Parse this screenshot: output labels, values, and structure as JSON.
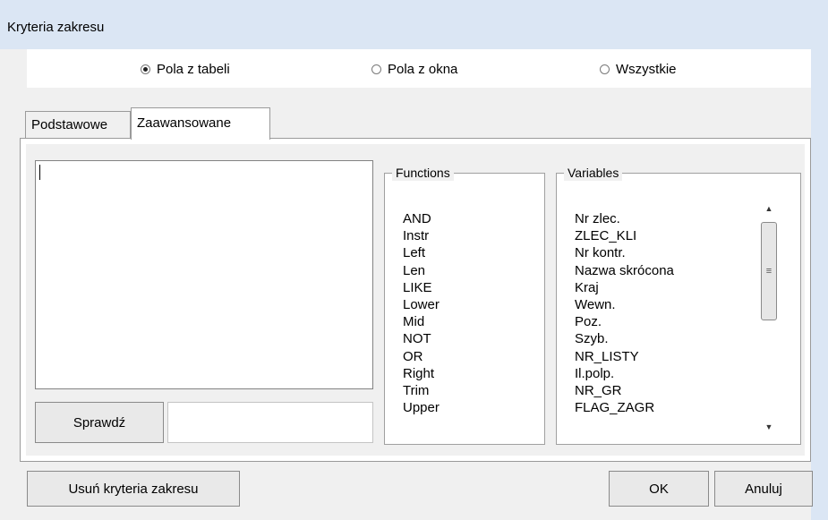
{
  "window": {
    "title": "Kryteria zakresu"
  },
  "scope": {
    "options": [
      {
        "label": "Pola z tabeli",
        "selected": true
      },
      {
        "label": "Pola z okna",
        "selected": false
      },
      {
        "label": "Wszystkie",
        "selected": false
      }
    ]
  },
  "tabs": [
    {
      "label": "Podstawowe",
      "active": false
    },
    {
      "label": "Zaawansowane",
      "active": true
    }
  ],
  "editor": {
    "value": "",
    "check_button": "Sprawdź",
    "result_text": ""
  },
  "functions": {
    "legend": "Functions",
    "items": [
      "AND",
      "Instr",
      "Left",
      "Len",
      "LIKE",
      "Lower",
      "Mid",
      "NOT",
      "OR",
      "Right",
      "Trim",
      "Upper"
    ]
  },
  "variables": {
    "legend": "Variables",
    "items": [
      "Nr zlec.",
      "ZLEC_KLI",
      "Nr kontr.",
      "Nazwa skrócona",
      "Kraj",
      "Wewn.",
      "Poz.",
      "Szyb.",
      "NR_LISTY",
      "Il.polp.",
      "NR_GR",
      "FLAG_ZAGR"
    ],
    "scrollbar": {
      "up_icon": "▲",
      "down_icon": "▼",
      "grip_icon": "≡"
    }
  },
  "footer": {
    "remove_label": "Usuń kryteria zakresu",
    "ok_label": "OK",
    "cancel_label": "Anuluj"
  }
}
